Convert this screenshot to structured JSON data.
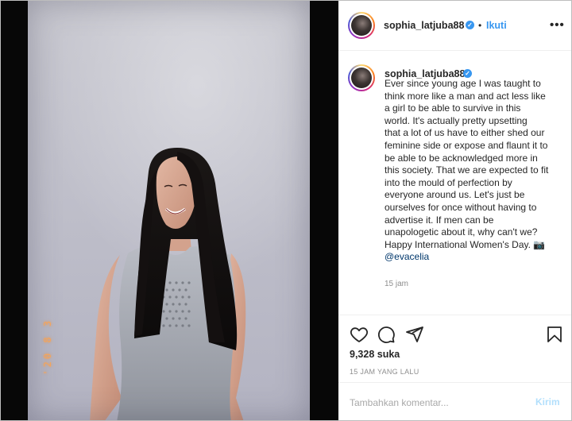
{
  "post": {
    "username": "sophia_latjuba88",
    "verified_mark": "✓",
    "separator": "•",
    "follow_label": "Ikuti",
    "more_icon": "•••",
    "photo_date_stamp": "'20 8 3",
    "caption_lines": [
      "Ever since young age I was taught to",
      "think more like a man and act less like",
      "a girl to be able to survive in this",
      "world. It's actually pretty upsetting",
      "that a lot of us have to either shed our",
      "feminine side or expose and flaunt it to",
      "be able to be acknowledged more in",
      "this society. That we are expected to fit",
      "into the mould of perfection by",
      "everyone around us. Let's just be",
      "ourselves for once without having to",
      "advertise it. If men can be",
      "unapologetic about it, why can't we?",
      "Happy International Women's Day. 📷"
    ],
    "mention": "@evacelia",
    "caption_time": "15 jam",
    "likes": "9,328 suka",
    "time_ago": "15 JAM YANG LALU",
    "comment_placeholder": "Tambahkan komentar...",
    "send_label": "Kirim"
  },
  "icons": {
    "like": "heart-icon",
    "comment": "comment-icon",
    "share": "share-icon",
    "save": "bookmark-icon",
    "more": "more-options-icon"
  },
  "colors": {
    "link": "#3897f0",
    "verified": "#3897f0",
    "send_disabled": "#b2dffc",
    "date_stamp": "#f5a55a"
  }
}
